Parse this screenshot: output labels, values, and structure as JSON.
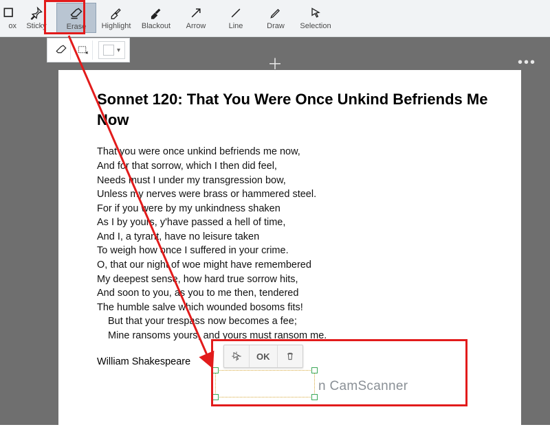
{
  "toolbar": {
    "tools": [
      {
        "id": "box",
        "label": "ox",
        "icon": "pin"
      },
      {
        "id": "sticky",
        "label": "Sticky",
        "icon": "pin"
      },
      {
        "id": "erase",
        "label": "Erase",
        "icon": "eraser",
        "active": true
      },
      {
        "id": "highlight",
        "label": "Highlight",
        "icon": "highlighter"
      },
      {
        "id": "blackout",
        "label": "Blackout",
        "icon": "blackout"
      },
      {
        "id": "arrow",
        "label": "Arrow",
        "icon": "arrow"
      },
      {
        "id": "line",
        "label": "Line",
        "icon": "line"
      },
      {
        "id": "draw",
        "label": "Draw",
        "icon": "pencil"
      },
      {
        "id": "selection",
        "label": "Selection",
        "icon": "cursor"
      }
    ],
    "sub": {
      "eraser_btn": "eraser",
      "fit_btn": "fit",
      "color": "#ffffff"
    }
  },
  "workspace": {
    "plus": "＋",
    "more": "•••"
  },
  "doc": {
    "title": "Sonnet 120: That You Were Once Unkind Befriends Me Now",
    "lines": [
      "That you were once unkind befriends me now,",
      "And for that sorrow, which I then did feel,",
      "Needs must I under my transgression bow,",
      "Unless my nerves were brass or hammered steel.",
      "For if you were by my unkindness shaken",
      "As I by yours, y'have passed a hell of time,",
      "And I, a tyrant, have no leisure taken",
      "To weigh how once I suffered in your crime.",
      "O, that our night of woe might have remembered",
      "My deepest sense, how hard true sorrow hits,",
      "And soon to you, as you to me then, tendered",
      "The humble salve which wounded bosoms fits!"
    ],
    "indent_lines": [
      "But that your trespass now becomes a fee;",
      "Mine ransoms yours, and yours must ransom me."
    ],
    "author": "William Shakespeare"
  },
  "selection_popup": {
    "move": "↖⁺",
    "ok": "OK",
    "delete": "🗑"
  },
  "watermark_remainder": "n CamScanner"
}
